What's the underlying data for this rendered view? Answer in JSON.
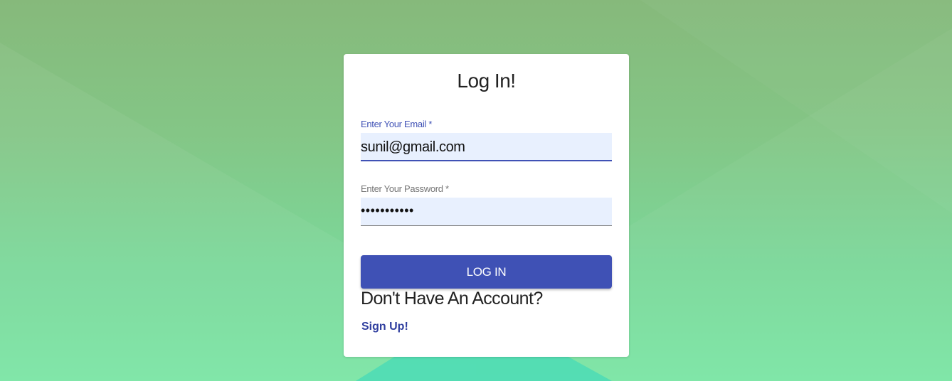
{
  "login_card": {
    "title": "Log In!",
    "email": {
      "label": "Enter Your Email *",
      "value": "sunil@gmail.com"
    },
    "password": {
      "label": "Enter Your Password *",
      "value": "•••••••••••"
    },
    "login_button_label": "LOG IN",
    "no_account_text": "Don't Have An Account?",
    "signup_link_label": "Sign Up!"
  },
  "colors": {
    "accent": "#3f51b5",
    "input_background": "#e8f0fe",
    "background_top": "#86b97b",
    "background_bottom": "#7be5a5"
  }
}
